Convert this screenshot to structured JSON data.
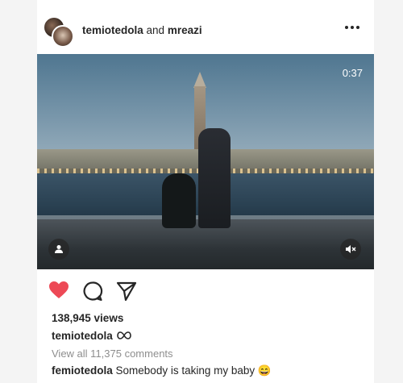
{
  "header": {
    "user1": "temiotedola",
    "joiner": "and",
    "user2": "mreazi",
    "more_icon": "more-horizontal-icon"
  },
  "video": {
    "duration": "0:37",
    "tag_icon": "user-tag-icon",
    "mute_icon": "speaker-muted-icon"
  },
  "actions": {
    "like_icon": "heart-filled-icon",
    "like_color": "#ed4956",
    "comment_icon": "comment-icon",
    "share_icon": "paper-plane-icon"
  },
  "stats": {
    "views": "138,945 views"
  },
  "owner": {
    "name": "temiotedola",
    "badge_icon": "infinity-icon"
  },
  "comments": {
    "view_all": "View all 11,375 comments"
  },
  "caption": {
    "user": "femiotedola",
    "text": "Somebody is taking my baby",
    "emoji": "😄"
  }
}
